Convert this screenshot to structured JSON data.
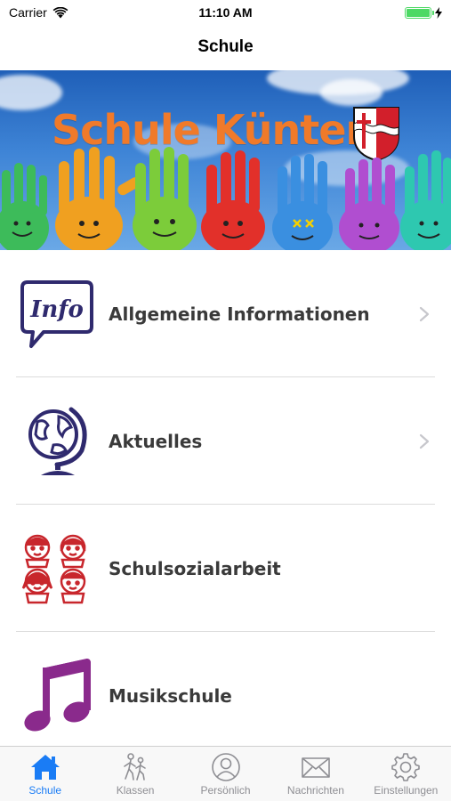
{
  "status_bar": {
    "carrier": "Carrier",
    "time": "11:10 AM"
  },
  "nav": {
    "title": "Schule"
  },
  "banner": {
    "title": "Schule Künten"
  },
  "menu": {
    "items": [
      {
        "label": "Allgemeine Informationen",
        "icon": "info-speech-bubble-icon",
        "has_chevron": true
      },
      {
        "label": "Aktuelles",
        "icon": "globe-icon",
        "has_chevron": true
      },
      {
        "label": "Schulsozialarbeit",
        "icon": "children-faces-icon",
        "has_chevron": false
      },
      {
        "label": "Musikschule",
        "icon": "music-note-icon",
        "has_chevron": false
      }
    ]
  },
  "tabs": [
    {
      "label": "Schule",
      "icon": "house-icon",
      "active": true
    },
    {
      "label": "Klassen",
      "icon": "walking-people-icon",
      "active": false
    },
    {
      "label": "Persönlich",
      "icon": "person-icon",
      "active": false
    },
    {
      "label": "Nachrichten",
      "icon": "envelope-icon",
      "active": false
    },
    {
      "label": "Einstellungen",
      "icon": "gear-icon",
      "active": false
    }
  ],
  "colors": {
    "accent": "#1a7cf5",
    "banner_title": "#f07a2a",
    "icon_navy": "#2f2a6e",
    "icon_red": "#c8262c",
    "icon_purple": "#8a2a8c",
    "battery": "#4cd964"
  }
}
